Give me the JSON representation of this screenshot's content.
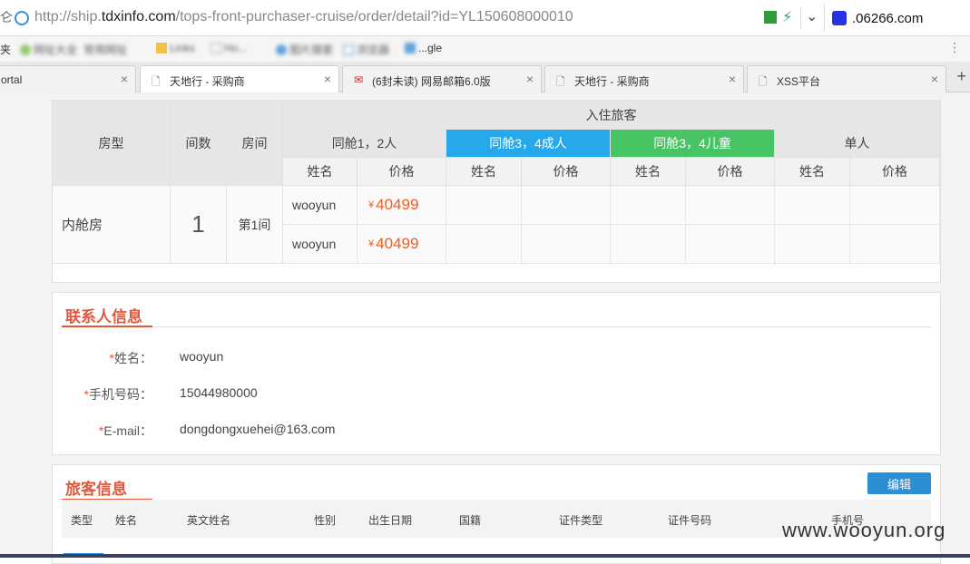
{
  "browser": {
    "url_prefix": "http://ship.",
    "url_domain": "tdxinfo.com",
    "url_path": "/tops-front-purchaser-cruise/order/detail?id=YL150608000010",
    "search_engine": ".06266.com",
    "left_edge_char": "仑",
    "bookmarks": [
      "夹",
      "网址大全",
      "常用网址",
      "Links",
      "Ho...",
      "图片搜索",
      "浏览器",
      "...gle"
    ],
    "tabs": [
      {
        "label": "ortal",
        "active": false
      },
      {
        "label": "天地行 - 采购商",
        "active": true
      },
      {
        "label": "(6封未读) 网易邮箱6.0版",
        "active": false
      },
      {
        "label": "天地行 - 采购商",
        "active": false
      },
      {
        "label": "XSS平台",
        "active": false
      }
    ]
  },
  "rooms_table": {
    "col_room_type": "房型",
    "col_count": "间数",
    "col_room": "房间",
    "col_guests": "入住旅客",
    "groups": [
      "同舱1，2人",
      "同舱3，4成人",
      "同舱3，4儿童",
      "单人"
    ],
    "sub_name": "姓名",
    "sub_price": "价格",
    "row": {
      "room_type": "内舱房",
      "count": "1",
      "room": "第1间",
      "guests": [
        {
          "name": "wooyun",
          "currency": "¥",
          "price": "40499"
        },
        {
          "name": "wooyun",
          "currency": "¥",
          "price": "40499"
        }
      ]
    }
  },
  "contact": {
    "title": "联系人信息",
    "fields": [
      {
        "req": "*",
        "label": "姓名：",
        "value": "wooyun"
      },
      {
        "req": "*",
        "label": "手机号码：",
        "value": "15044980000"
      },
      {
        "req": "*",
        "label": "E-mail：",
        "value": "dongdongxuehei@163.com"
      }
    ]
  },
  "passengers": {
    "title": "旅客信息",
    "edit_label": "编辑",
    "columns": [
      "类型",
      "姓名",
      "英文姓名",
      "性别",
      "出生日期",
      "国籍",
      "证件类型",
      "证件号码",
      "手机号"
    ]
  },
  "watermark": "www.wooyun.org",
  "colors": {
    "blue": "#26a9ec",
    "green": "#47c463",
    "accent": "#e1573c",
    "price": "#f25c1d"
  }
}
